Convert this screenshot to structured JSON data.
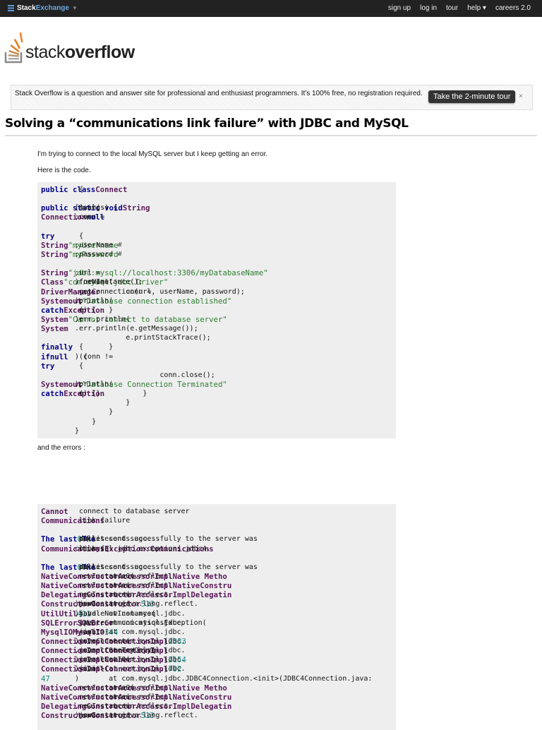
{
  "topbar": {
    "brand_a": "Stack",
    "brand_b": "Exchange",
    "links": [
      "sign up",
      "log in",
      "tour",
      "help ▾",
      "careers 2.0"
    ]
  },
  "logo": {
    "text_a": "stack",
    "text_b": "overflow"
  },
  "banner": {
    "text": "Stack Overflow is a question and answer site for professional and enthusiast programmers. It's 100% free, no registration required.",
    "button": "Take the 2-minute tour",
    "close": "×"
  },
  "question": {
    "title": "Solving a “communications link failure” with JDBC and MySQL",
    "p1": "I'm trying to connect to the local MySQL server but I keep getting an error.",
    "p2": "Here is the code.",
    "p3": "and the errors :"
  },
  "code_lines": [
    [
      [
        "k",
        "public class"
      ],
      [
        "p",
        " "
      ],
      [
        "t",
        "Connect"
      ],
      [
        "p",
        " {"
      ]
    ],
    [],
    [
      [
        "p",
        "    "
      ],
      [
        "k",
        "public static void"
      ],
      [
        "p",
        " main("
      ],
      [
        "t",
        "String"
      ],
      [
        "p",
        "[] args) {"
      ]
    ],
    [
      [
        "p",
        "        "
      ],
      [
        "t",
        "Connection"
      ],
      [
        "p",
        " conn = "
      ],
      [
        "k",
        "null"
      ],
      [
        "p",
        ";"
      ]
    ],
    [],
    [
      [
        "p",
        "        "
      ],
      [
        "k",
        "try"
      ],
      [
        "p",
        " {"
      ]
    ],
    [
      [
        "p",
        "            "
      ],
      [
        "t",
        "String"
      ],
      [
        "p",
        " userName = "
      ],
      [
        "s",
        "\"myUsername\""
      ],
      [
        "p",
        ";"
      ]
    ],
    [
      [
        "p",
        "            "
      ],
      [
        "t",
        "String"
      ],
      [
        "p",
        " password = "
      ],
      [
        "s",
        "\"myPassword\""
      ],
      [
        "p",
        ";"
      ]
    ],
    [],
    [
      [
        "p",
        "            "
      ],
      [
        "t",
        "String"
      ],
      [
        "p",
        " url = "
      ],
      [
        "s",
        "\"jdbc:mysql://localhost:3306/myDatabaseName\""
      ],
      [
        "p",
        ";"
      ]
    ],
    [
      [
        "p",
        "            "
      ],
      [
        "t",
        "Class"
      ],
      [
        "p",
        ".forName("
      ],
      [
        "s",
        "\"com.mysql.jdbc.Driver\""
      ],
      [
        "p",
        ").newInstance();"
      ]
    ],
    [
      [
        "p",
        "            conn = "
      ],
      [
        "t",
        "DriverManager"
      ],
      [
        "p",
        ".getConnection(url, userName, password);"
      ]
    ],
    [
      [
        "p",
        "            "
      ],
      [
        "t",
        "System"
      ],
      [
        "p",
        "."
      ],
      [
        "t",
        "out"
      ],
      [
        "p",
        ".println("
      ],
      [
        "s",
        "\"Database connection established\""
      ],
      [
        "p",
        ");"
      ]
    ],
    [
      [
        "p",
        "        } "
      ],
      [
        "k",
        "catch"
      ],
      [
        "p",
        " ("
      ],
      [
        "t",
        "Exception"
      ],
      [
        "p",
        " e) {"
      ]
    ],
    [
      [
        "p",
        "            "
      ],
      [
        "t",
        "System"
      ],
      [
        "p",
        ".err.println("
      ],
      [
        "s",
        "\"Cannot connect to database server\""
      ],
      [
        "p",
        ");"
      ]
    ],
    [
      [
        "p",
        "            "
      ],
      [
        "t",
        "System"
      ],
      [
        "p",
        ".err.println(e.getMessage());"
      ]
    ],
    [
      [
        "p",
        "            e.printStackTrace();"
      ]
    ],
    [
      [
        "p",
        "        } "
      ],
      [
        "k",
        "finally"
      ],
      [
        "p",
        " {"
      ]
    ],
    [
      [
        "p",
        "            "
      ],
      [
        "k",
        "if"
      ],
      [
        "p",
        " (conn != "
      ],
      [
        "k",
        "null"
      ],
      [
        "p",
        ") {"
      ]
    ],
    [
      [
        "p",
        "                "
      ],
      [
        "k",
        "try"
      ],
      [
        "p",
        " {"
      ]
    ],
    [
      [
        "p",
        "                    conn.close();"
      ]
    ],
    [
      [
        "p",
        "                    "
      ],
      [
        "t",
        "System"
      ],
      [
        "p",
        "."
      ],
      [
        "t",
        "out"
      ],
      [
        "p",
        ".println("
      ],
      [
        "s",
        "\"Database Connection Terminated\""
      ],
      [
        "p",
        ");"
      ]
    ],
    [
      [
        "p",
        "                } "
      ],
      [
        "k",
        "catch"
      ],
      [
        "p",
        " ("
      ],
      [
        "t",
        "Exception"
      ],
      [
        "p",
        " e) {}"
      ]
    ],
    [
      [
        "p",
        "            }"
      ]
    ],
    [
      [
        "p",
        "        }"
      ]
    ],
    [
      [
        "p",
        "    }"
      ]
    ],
    [
      [
        "p",
        "}"
      ]
    ]
  ],
  "error_lines": [
    [
      [
        "t",
        "Cannot"
      ],
      [
        "p",
        " connect to database server"
      ]
    ],
    [
      [
        "t",
        "Communications"
      ],
      [
        "p",
        " link failure"
      ]
    ],
    [],
    [
      [
        "k",
        "The last"
      ],
      [
        "p",
        " packet sent successfully to the server was "
      ],
      [
        "n",
        "0"
      ],
      [
        "p",
        " milliseconds ago. "
      ],
      [
        "k",
        "The"
      ],
      [
        "p",
        " dr"
      ]
    ],
    [
      [
        "p",
        "com.mysql.jdbc.exceptions.jdbc4."
      ],
      [
        "t",
        "CommunicationsException:"
      ],
      [
        "p",
        " "
      ],
      [
        "t",
        "Communications"
      ],
      [
        "p",
        " link f"
      ]
    ],
    [],
    [
      [
        "k",
        "The last"
      ],
      [
        "p",
        " packet sent successfully to the server was "
      ],
      [
        "n",
        "0"
      ],
      [
        "p",
        " milliseconds ago. "
      ],
      [
        "k",
        "The"
      ],
      [
        "p",
        " dr"
      ]
    ],
    [
      [
        "p",
        "        at sun.reflect."
      ],
      [
        "t",
        "NativeConstructorAccessorImpl"
      ],
      [
        "p",
        ".newInstance0("
      ],
      [
        "t",
        "Native Metho"
      ]
    ],
    [
      [
        "p",
        "        at sun.reflect."
      ],
      [
        "t",
        "NativeConstructorAccessorImpl"
      ],
      [
        "p",
        ".newInstance("
      ],
      [
        "t",
        "NativeConstru"
      ]
    ],
    [
      [
        "p",
        "        at sun.reflect."
      ],
      [
        "t",
        "DelegatingConstructorAccessorImpl"
      ],
      [
        "p",
        ".newInstance("
      ],
      [
        "t",
        "Delegatin"
      ]
    ],
    [
      [
        "p",
        "        at java.lang.reflect."
      ],
      [
        "t",
        "Constructor"
      ],
      [
        "p",
        ".newInstance("
      ],
      [
        "t",
        "Constructor"
      ],
      [
        "p",
        ".java:"
      ],
      [
        "n",
        "513"
      ],
      [
        "p",
        ")"
      ]
    ],
    [
      [
        "p",
        "        at com.mysql.jdbc."
      ],
      [
        "t",
        "Util"
      ],
      [
        "p",
        ".handleNewInstance("
      ],
      [
        "t",
        "Util"
      ],
      [
        "p",
        ".java:"
      ],
      [
        "n",
        "411"
      ],
      [
        "p",
        ")"
      ]
    ],
    [
      [
        "p",
        "        at com.mysql.jdbc."
      ],
      [
        "t",
        "SQLError"
      ],
      [
        "p",
        ".createCommunicationsException("
      ],
      [
        "t",
        "SQLError"
      ],
      [
        "p",
        ".java"
      ]
    ],
    [
      [
        "p",
        "        at com.mysql.jdbc."
      ],
      [
        "t",
        "MysqlIO"
      ],
      [
        "p",
        ".<init>("
      ],
      [
        "t",
        "MysqlIO"
      ],
      [
        "p",
        ".java:"
      ],
      [
        "n",
        "344"
      ],
      [
        "p",
        ")"
      ]
    ],
    [
      [
        "p",
        "        at com.mysql.jdbc."
      ],
      [
        "t",
        "ConnectionImpl"
      ],
      [
        "p",
        ".coreConnect("
      ],
      [
        "t",
        "ConnectionImpl"
      ],
      [
        "p",
        ".java:"
      ],
      [
        "n",
        "2333"
      ],
      [
        "p",
        ")"
      ]
    ],
    [
      [
        "p",
        "        at com.mysql.jdbc."
      ],
      [
        "t",
        "ConnectionImpl"
      ],
      [
        "p",
        ".connectOneTryOnly("
      ],
      [
        "t",
        "ConnectionImpl"
      ],
      [
        "p",
        ".java"
      ]
    ],
    [
      [
        "p",
        "        at com.mysql.jdbc."
      ],
      [
        "t",
        "ConnectionImpl"
      ],
      [
        "p",
        ".createNewIO("
      ],
      [
        "t",
        "ConnectionImpl"
      ],
      [
        "p",
        ".java:"
      ],
      [
        "n",
        "2154"
      ],
      [
        "p",
        ")"
      ]
    ],
    [
      [
        "p",
        "        at com.mysql.jdbc."
      ],
      [
        "t",
        "ConnectionImpl"
      ],
      [
        "p",
        ".<init>("
      ],
      [
        "t",
        "ConnectionImpl"
      ],
      [
        "p",
        ".java:"
      ],
      [
        "n",
        "792"
      ],
      [
        "p",
        ")"
      ]
    ],
    [
      [
        "p",
        "        at com.mysql.jdbc.JDBC4Connection.<init>(JDBC4Connection.java:"
      ],
      [
        "n",
        "47"
      ],
      [
        "p",
        ")"
      ]
    ],
    [
      [
        "p",
        "        at sun.reflect."
      ],
      [
        "t",
        "NativeConstructorAccessorImpl"
      ],
      [
        "p",
        ".newInstance0("
      ],
      [
        "t",
        "Native Metho"
      ]
    ],
    [
      [
        "p",
        "        at sun.reflect."
      ],
      [
        "t",
        "NativeConstructorAccessorImpl"
      ],
      [
        "p",
        ".newInstance("
      ],
      [
        "t",
        "NativeConstru"
      ]
    ],
    [
      [
        "p",
        "        at sun.reflect."
      ],
      [
        "t",
        "DelegatingConstructorAccessorImpl"
      ],
      [
        "p",
        ".newInstance("
      ],
      [
        "t",
        "Delegatin"
      ]
    ],
    [
      [
        "p",
        "        at java.lang.reflect."
      ],
      [
        "t",
        "Constructor"
      ],
      [
        "p",
        ".newInstance("
      ],
      [
        "t",
        "Constructor"
      ],
      [
        "p",
        ".java:"
      ],
      [
        "n",
        "513"
      ],
      [
        "p",
        ")"
      ]
    ]
  ]
}
